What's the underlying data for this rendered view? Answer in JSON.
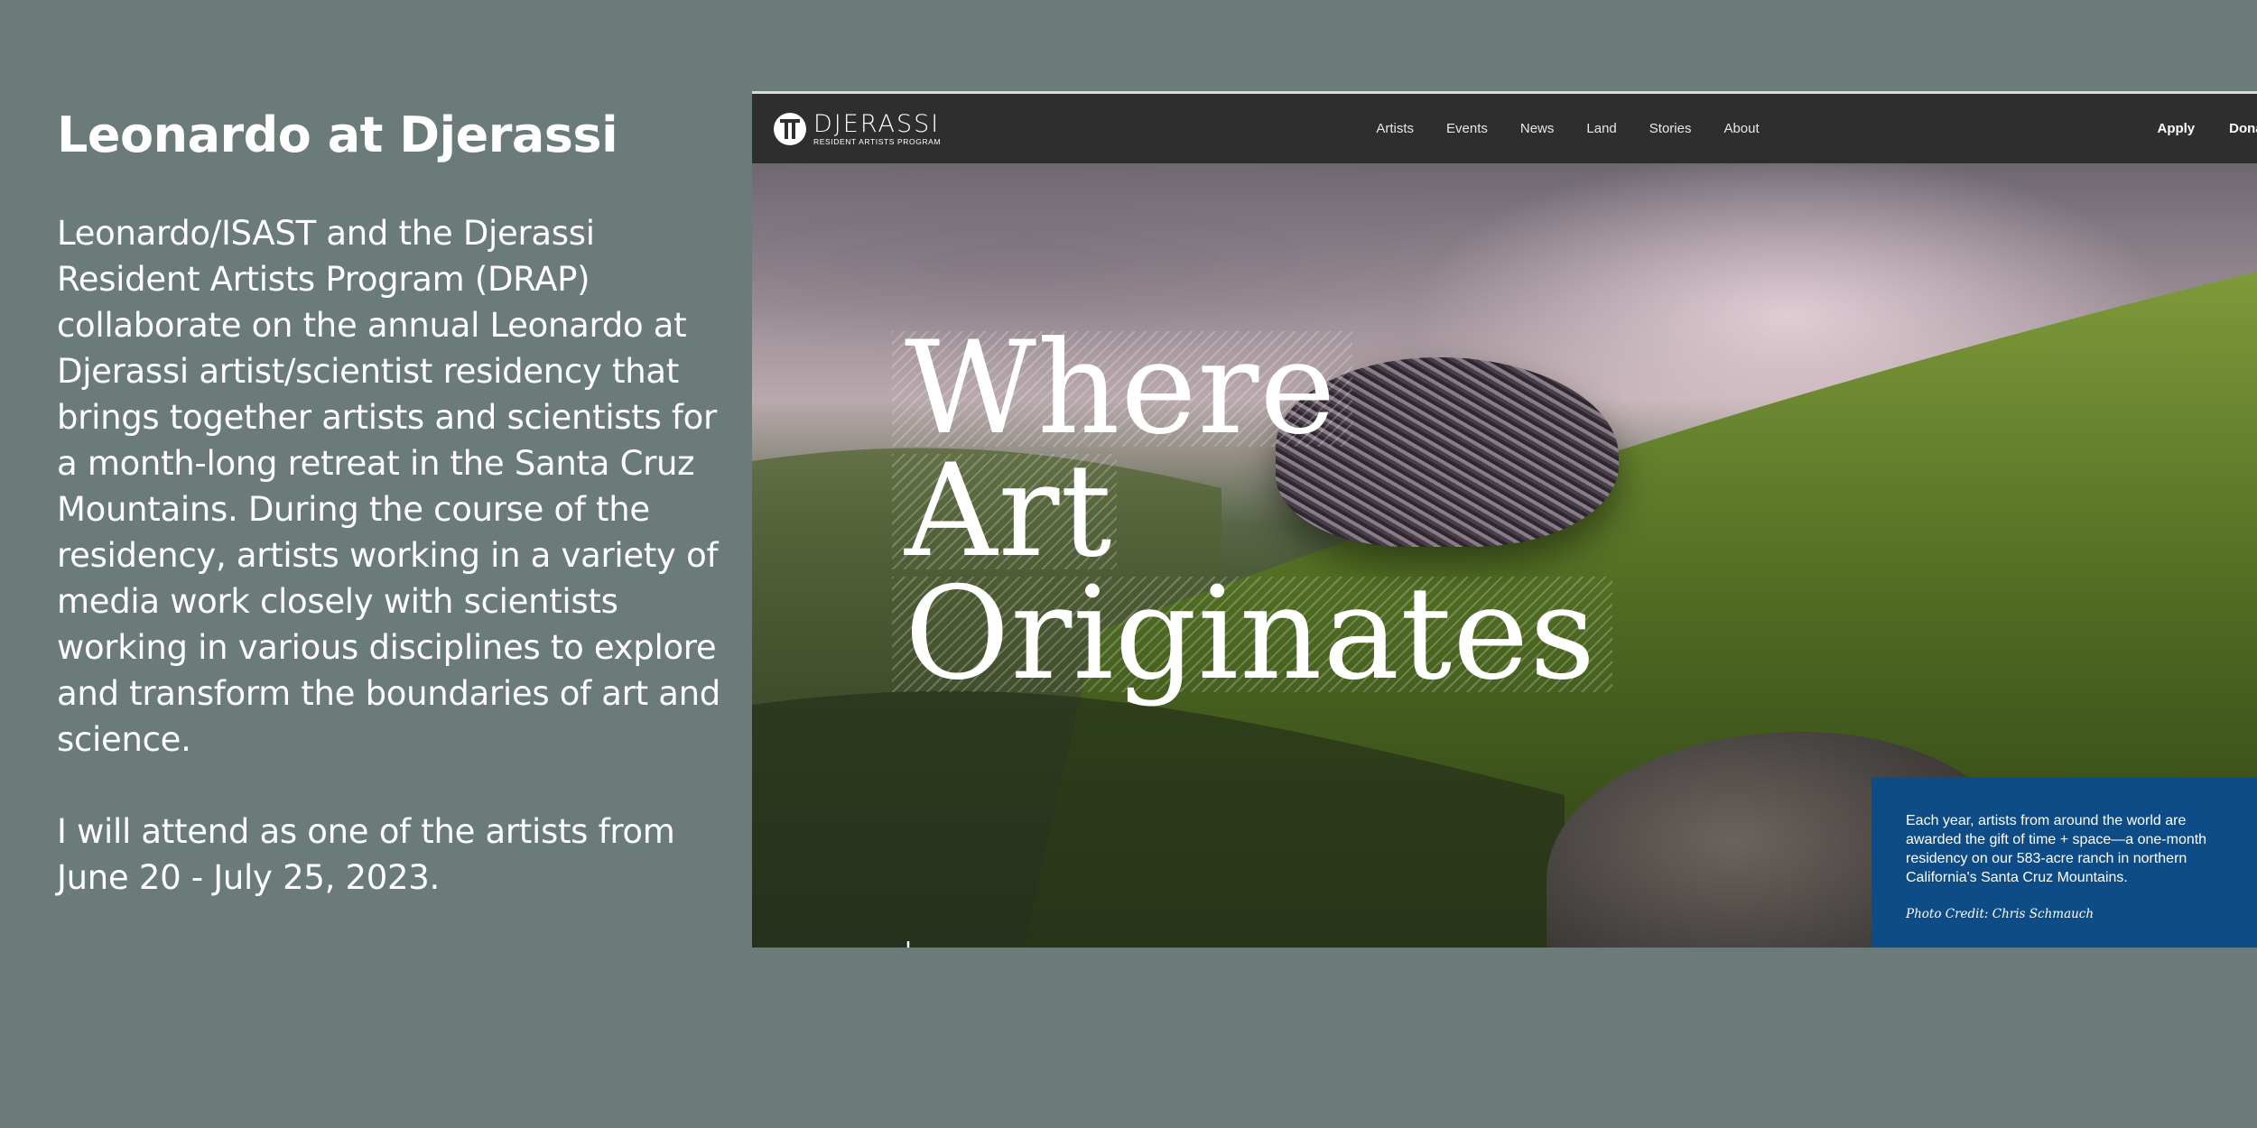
{
  "intro": {
    "title": "Leonardo at Djerassi",
    "paragraph_1": "Leonardo/ISAST and the Djerassi Resident Artists Program (DRAP) collaborate on the annual Leonardo at Djerassi artist/scientist residency that brings together artists and scientists for a month-long retreat in the Santa Cruz Mountains. During the course of the residency, artists working in a variety of media work closely with scientists working in various disciplines to explore and transform the boundaries of art and science.",
    "paragraph_2": "I will attend as one of the artists from June 20 - July 25, 2023."
  },
  "site": {
    "logo": {
      "name": "DJERASSI",
      "subtitle": "RESIDENT ARTISTS PROGRAM",
      "icon": "djerassi-logo-icon"
    },
    "nav": {
      "links": [
        "Artists",
        "Events",
        "News",
        "Land",
        "Stories",
        "About"
      ],
      "apply": "Apply",
      "donate": "Donate"
    },
    "hero": {
      "headline": [
        "Where",
        "Art",
        "Originates"
      ],
      "scroll_icon": "down-arrow-icon"
    },
    "info_card": {
      "text": "Each year, artists from around the world are awarded the gift of time + space—a one-month residency on our 583-acre ranch in northern California's Santa Cruz Mountains.",
      "credit": "Photo Credit: Chris Schmauch",
      "slides": 5,
      "active_slide": 1
    }
  },
  "colors": {
    "page_background": "#6b7b7a",
    "nav_background": "#2e2e2e",
    "card_background": "#0d4c86",
    "active_dot": "#e25a2c"
  }
}
